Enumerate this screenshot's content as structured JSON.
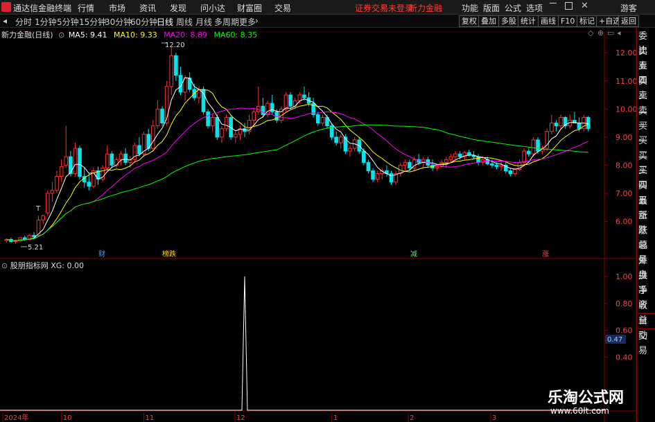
{
  "app": {
    "title": "通达信金融终端"
  },
  "menu": {
    "items": [
      "行情",
      "市场",
      "资讯",
      "发现",
      "问小达",
      "财富圈",
      "交易"
    ],
    "warning": "证券交易未登录",
    "stock_name": "新力金融",
    "right": [
      "功能",
      "版面",
      "公式",
      "选项"
    ],
    "guest": "游客"
  },
  "periods": {
    "items": [
      "分时",
      "1分钟",
      "5分钟",
      "15分钟",
      "30分钟",
      "60分钟",
      "日线",
      "周线",
      "月线",
      "多周期",
      "更多"
    ],
    "active": "日线"
  },
  "toolbar": {
    "buttons": [
      "复权",
      "叠加",
      "多股",
      "统计",
      "画线",
      "F10",
      "标记",
      "+自选",
      "返回"
    ]
  },
  "main_chart": {
    "header_title": "新力金融(日线)",
    "ma": [
      {
        "label": "MA5: 9.41",
        "color": "#ffffff"
      },
      {
        "label": "MA10: 9.33",
        "color": "#ffff00"
      },
      {
        "label": "MA20: 8.89",
        "color": "#ff00ff"
      },
      {
        "label": "MA60: 8.35",
        "color": "#00ff00"
      }
    ],
    "y_ticks": [
      "12.00",
      "11.00",
      "10.00",
      "9.00",
      "8.00",
      "7.00",
      "6.00"
    ],
    "high_label": "12.20",
    "low_label": "5.21",
    "events": [
      {
        "label": "财",
        "color": "#4aa3ff"
      },
      {
        "label": "榜跌",
        "color": "#ffd400"
      },
      {
        "label": "减",
        "color": "#6fdc6f"
      },
      {
        "label": "涨",
        "color": "#ff5050"
      }
    ]
  },
  "indicator": {
    "header": "股朋指标网 XG: 0.00",
    "y_ticks": [
      "1.00",
      "0.80",
      "0.60",
      "0.40"
    ],
    "current": "0.47"
  },
  "date_axis": {
    "labels": [
      "2024年",
      "10",
      "11",
      "12",
      "1",
      "2",
      "3"
    ]
  },
  "right_panel": {
    "items": [
      "委比",
      "卖五",
      "卖四",
      "卖三",
      "卖二",
      "卖一",
      "买一",
      "买二",
      "买三",
      "买四",
      "买五",
      "最新",
      "涨跌",
      "涨幅",
      "总量",
      "外盘",
      "换手",
      "净资",
      "收益",
      "自动",
      "交易"
    ]
  },
  "watermark": {
    "main": "乐淘公式网",
    "sub": "www.60lt.com"
  },
  "chart_data": {
    "type": "candlestick",
    "title": "新力金融(日线)",
    "ylim": [
      5.0,
      12.4
    ],
    "candles": [
      [
        5.32,
        5.4,
        5.24,
        5.36
      ],
      [
        5.36,
        5.42,
        5.25,
        5.28
      ],
      [
        5.28,
        5.35,
        5.21,
        5.3
      ],
      [
        5.3,
        5.45,
        5.26,
        5.42
      ],
      [
        5.42,
        5.5,
        5.3,
        5.35
      ],
      [
        5.35,
        5.55,
        5.33,
        5.5
      ],
      [
        5.5,
        5.62,
        5.4,
        5.45
      ],
      [
        5.5,
        6.2,
        5.48,
        6.05
      ],
      [
        6.05,
        6.25,
        5.9,
        6.2
      ],
      [
        6.3,
        7.1,
        6.2,
        7.0
      ],
      [
        7.0,
        7.4,
        6.7,
        7.1
      ],
      [
        7.1,
        7.8,
        7.0,
        7.6
      ],
      [
        7.6,
        8.2,
        7.4,
        7.95
      ],
      [
        8.0,
        9.4,
        7.9,
        8.3
      ],
      [
        8.3,
        8.5,
        7.6,
        7.7
      ],
      [
        7.7,
        8.8,
        7.6,
        8.6
      ],
      [
        8.6,
        8.7,
        7.5,
        7.6
      ],
      [
        7.6,
        7.9,
        7.2,
        7.4
      ],
      [
        7.4,
        7.7,
        7.1,
        7.25
      ],
      [
        7.25,
        7.9,
        7.2,
        7.8
      ],
      [
        7.8,
        7.95,
        7.3,
        7.5
      ],
      [
        7.5,
        8.0,
        7.4,
        7.9
      ],
      [
        7.9,
        8.7,
        7.8,
        8.4
      ],
      [
        8.4,
        8.5,
        7.9,
        8.0
      ],
      [
        8.0,
        8.3,
        7.9,
        8.2
      ],
      [
        8.2,
        8.5,
        8.0,
        8.4
      ],
      [
        8.4,
        8.6,
        8.0,
        8.1
      ],
      [
        8.1,
        8.3,
        7.9,
        8.2
      ],
      [
        8.2,
        8.8,
        8.1,
        8.7
      ],
      [
        8.7,
        9.0,
        8.3,
        8.4
      ],
      [
        8.4,
        9.2,
        8.3,
        9.1
      ],
      [
        9.1,
        9.3,
        8.5,
        8.6
      ],
      [
        8.6,
        9.6,
        8.5,
        9.4
      ],
      [
        9.4,
        10.3,
        9.3,
        10.0
      ],
      [
        10.0,
        10.1,
        9.4,
        9.5
      ],
      [
        9.5,
        11.0,
        9.4,
        10.8
      ],
      [
        10.8,
        12.2,
        10.5,
        11.9
      ],
      [
        11.9,
        12.0,
        11.0,
        11.2
      ],
      [
        11.2,
        11.5,
        10.5,
        10.6
      ],
      [
        10.6,
        11.2,
        10.3,
        11.1
      ],
      [
        11.1,
        11.3,
        10.6,
        10.7
      ],
      [
        10.7,
        10.9,
        10.3,
        10.4
      ],
      [
        10.4,
        10.8,
        10.2,
        10.7
      ],
      [
        10.7,
        10.8,
        9.8,
        9.9
      ],
      [
        9.9,
        10.0,
        9.3,
        9.4
      ],
      [
        9.4,
        9.8,
        9.2,
        9.7
      ],
      [
        9.7,
        9.8,
        8.9,
        9.0
      ],
      [
        9.0,
        9.4,
        8.8,
        9.3
      ],
      [
        9.3,
        9.8,
        9.2,
        9.7
      ],
      [
        9.7,
        9.8,
        8.9,
        9.0
      ],
      [
        9.0,
        9.2,
        8.8,
        9.1
      ],
      [
        9.1,
        9.4,
        8.9,
        9.3
      ],
      [
        9.3,
        9.5,
        9.0,
        9.2
      ],
      [
        9.2,
        9.8,
        9.1,
        9.6
      ],
      [
        9.6,
        10.0,
        9.4,
        9.9
      ],
      [
        9.9,
        10.8,
        9.8,
        10.1
      ],
      [
        10.1,
        10.4,
        9.7,
        9.8
      ],
      [
        9.8,
        10.3,
        9.7,
        10.2
      ],
      [
        10.2,
        10.5,
        9.8,
        9.9
      ],
      [
        9.9,
        10.0,
        9.5,
        9.6
      ],
      [
        9.6,
        10.1,
        9.5,
        10.0
      ],
      [
        10.0,
        10.6,
        9.9,
        10.5
      ],
      [
        10.5,
        10.6,
        10.0,
        10.1
      ],
      [
        10.1,
        10.4,
        10.0,
        10.3
      ],
      [
        10.3,
        10.6,
        10.2,
        10.5
      ],
      [
        10.5,
        10.8,
        10.3,
        10.4
      ],
      [
        10.4,
        10.6,
        10.1,
        10.2
      ],
      [
        10.2,
        10.4,
        9.7,
        9.8
      ],
      [
        9.8,
        9.9,
        9.4,
        9.5
      ],
      [
        9.5,
        9.8,
        9.4,
        9.7
      ],
      [
        9.7,
        9.8,
        9.3,
        9.4
      ],
      [
        9.4,
        9.5,
        8.9,
        9.0
      ],
      [
        9.0,
        9.2,
        8.7,
        8.8
      ],
      [
        8.8,
        9.1,
        8.6,
        9.0
      ],
      [
        9.0,
        9.1,
        8.4,
        8.5
      ],
      [
        8.5,
        8.7,
        8.3,
        8.6
      ],
      [
        8.6,
        9.0,
        8.5,
        8.9
      ],
      [
        8.9,
        9.0,
        8.4,
        8.5
      ],
      [
        8.5,
        8.6,
        8.0,
        8.1
      ],
      [
        8.1,
        8.2,
        7.7,
        7.8
      ],
      [
        7.8,
        7.9,
        7.4,
        7.5
      ],
      [
        7.5,
        7.8,
        7.4,
        7.7
      ],
      [
        7.7,
        7.9,
        7.5,
        7.8
      ],
      [
        7.8,
        8.0,
        7.6,
        7.7
      ],
      [
        7.7,
        7.8,
        7.3,
        7.4
      ],
      [
        7.4,
        7.8,
        7.3,
        7.7
      ],
      [
        7.7,
        8.1,
        7.6,
        8.0
      ],
      [
        8.0,
        8.2,
        7.8,
        8.1
      ],
      [
        8.1,
        8.2,
        7.8,
        7.9
      ],
      [
        7.9,
        8.3,
        7.8,
        8.2
      ],
      [
        8.2,
        8.4,
        8.0,
        8.1
      ],
      [
        8.1,
        8.3,
        7.9,
        8.2
      ],
      [
        8.2,
        8.3,
        7.9,
        8.0
      ],
      [
        8.0,
        8.2,
        7.8,
        7.9
      ],
      [
        7.9,
        8.0,
        7.8,
        7.95
      ],
      [
        7.95,
        8.2,
        7.9,
        8.1
      ],
      [
        8.1,
        8.3,
        7.9,
        8.2
      ],
      [
        8.2,
        8.4,
        8.1,
        8.3
      ],
      [
        8.3,
        8.5,
        8.2,
        8.4
      ],
      [
        8.4,
        8.5,
        8.2,
        8.3
      ],
      [
        8.3,
        8.5,
        8.2,
        8.45
      ],
      [
        8.45,
        8.55,
        8.3,
        8.35
      ],
      [
        8.35,
        8.5,
        8.2,
        8.3
      ],
      [
        8.3,
        8.4,
        8.0,
        8.1
      ],
      [
        8.1,
        8.3,
        8.0,
        8.2
      ],
      [
        8.2,
        8.3,
        8.0,
        8.05
      ],
      [
        8.05,
        8.2,
        7.9,
        8.0
      ],
      [
        8.0,
        8.1,
        7.85,
        7.95
      ],
      [
        7.95,
        8.1,
        7.8,
        8.0
      ],
      [
        8.0,
        8.1,
        7.7,
        7.8
      ],
      [
        7.8,
        7.9,
        7.6,
        7.7
      ],
      [
        7.7,
        7.9,
        7.6,
        7.85
      ],
      [
        7.85,
        8.2,
        7.8,
        8.1
      ],
      [
        8.1,
        8.6,
        8.0,
        8.5
      ],
      [
        8.5,
        8.6,
        8.3,
        8.4
      ],
      [
        8.4,
        9.0,
        8.3,
        8.9
      ],
      [
        8.9,
        9.0,
        8.4,
        8.5
      ],
      [
        8.5,
        8.7,
        8.4,
        8.6
      ],
      [
        8.6,
        9.3,
        8.5,
        9.2
      ],
      [
        9.2,
        9.8,
        9.1,
        9.5
      ],
      [
        9.5,
        9.6,
        9.2,
        9.4
      ],
      [
        9.4,
        9.8,
        9.3,
        9.7
      ],
      [
        9.7,
        9.75,
        9.3,
        9.4
      ],
      [
        9.4,
        9.8,
        9.3,
        9.6
      ],
      [
        9.6,
        9.9,
        9.5,
        9.5
      ],
      [
        9.5,
        9.7,
        9.2,
        9.3
      ],
      [
        9.3,
        9.8,
        9.2,
        9.7
      ],
      [
        9.7,
        9.75,
        9.2,
        9.3
      ]
    ],
    "indicator_values": "zero except a single spike to 1.00 in mid December"
  }
}
